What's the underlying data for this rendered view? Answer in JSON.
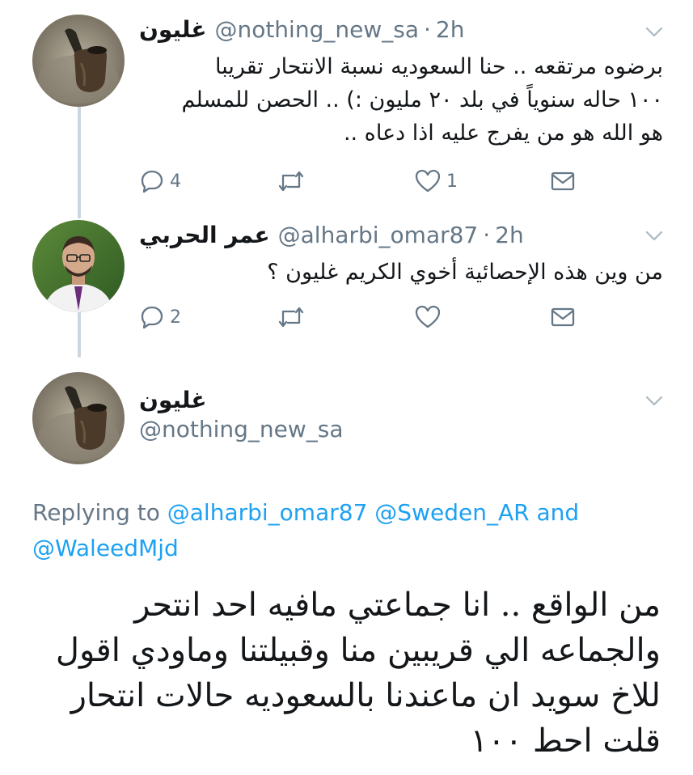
{
  "tweets": [
    {
      "name": "غليون",
      "handle": "@nothing_new_sa",
      "time": "2h",
      "lines": [
        "برضوه مرتقعه .. حنا السعوديه نسبة الانتحار تقريبا",
        "١٠٠ حاله سنوياً في بلد ٢٠ مليون :) .. الحصن للمسلم",
        "هو الله هو من يفرج عليه اذا دعاه .."
      ],
      "reply_count": "4",
      "retweet_count": "",
      "like_count": "1"
    },
    {
      "name": "عمر الحربي",
      "handle": "@alharbi_omar87",
      "time": "2h",
      "lines": [
        "من وين هذه الإحصائية أخوي الكريم غليون ؟"
      ],
      "reply_count": "2",
      "retweet_count": "",
      "like_count": ""
    }
  ],
  "main": {
    "name": "غليون",
    "handle": "@nothing_new_sa",
    "replying_prefix": "Replying to",
    "mention1": "@alharbi_omar87",
    "mention2": "@Sweden_AR",
    "and": "and",
    "mention3": "@WaleedMjd",
    "lines": [
      "من الواقع .. انا جماعتي مافيه احد انتحر",
      "والجماعه الي قريبين منا وقبيلتنا وماودي اقول",
      "للاخ سويد ان ماعندنا بالسعوديه حالات انتحار",
      "قلت احط ١٠٠"
    ]
  },
  "icons": {
    "reply": "reply-icon",
    "retweet": "retweet-icon",
    "like": "heart-icon",
    "dm": "envelope-icon",
    "menu": "chevron-down-icon"
  },
  "colors": {
    "secondary": "#657786",
    "link": "#1da1f2",
    "thread": "#ccd6dd"
  }
}
